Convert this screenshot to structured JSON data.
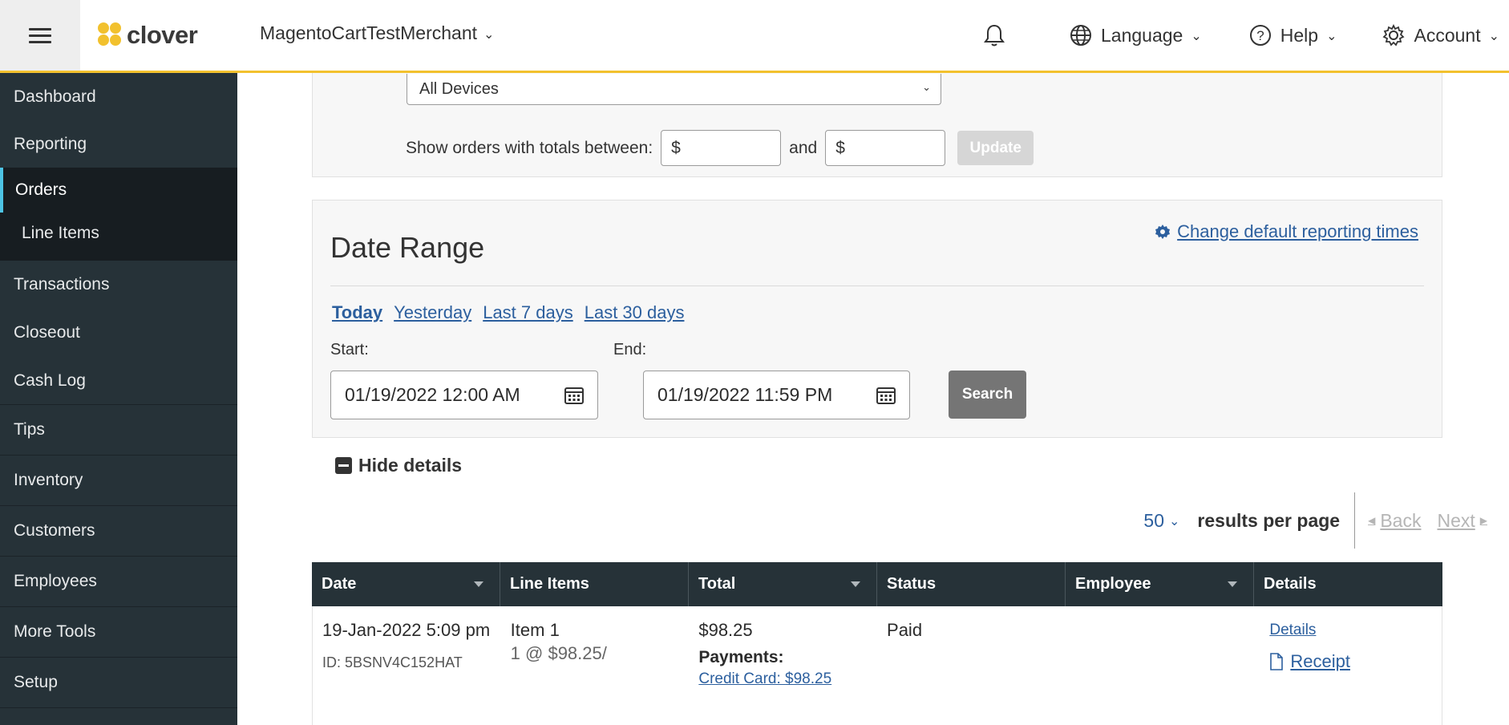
{
  "header": {
    "logo_text": "clover",
    "merchant": "MagentoCartTestMerchant",
    "language": "Language",
    "help": "Help",
    "account": "Account"
  },
  "sidebar": {
    "items": [
      {
        "label": "Dashboard"
      },
      {
        "label": "Reporting"
      },
      {
        "label": "Orders"
      },
      {
        "label": "Line Items"
      },
      {
        "label": "Transactions"
      },
      {
        "label": "Closeout"
      },
      {
        "label": "Cash Log"
      },
      {
        "label": "Tips"
      },
      {
        "label": "Inventory"
      },
      {
        "label": "Customers"
      },
      {
        "label": "Employees"
      },
      {
        "label": "More Tools"
      },
      {
        "label": "Setup"
      }
    ]
  },
  "filters": {
    "device_value": "All Devices",
    "totals_label": "Show orders with totals between:",
    "min_value": "$",
    "and_label": "and",
    "max_value": "$",
    "update_label": "Update"
  },
  "date_range": {
    "title": "Date Range",
    "change_link": "Change default reporting times",
    "quick": [
      "Today",
      "Yesterday",
      "Last 7 days",
      "Last 30 days"
    ],
    "start_label": "Start:",
    "start_value": "01/19/2022 12:00  AM",
    "end_label": "End:",
    "end_value": "01/19/2022 11:59  PM",
    "search_label": "Search"
  },
  "details_toggle": "Hide details",
  "pager": {
    "per_page": "50",
    "per_page_label": "results per page",
    "back": "Back",
    "next": "Next"
  },
  "table": {
    "columns": [
      "Date",
      "Line Items",
      "Total",
      "Status",
      "Employee",
      "Details"
    ],
    "rows": [
      {
        "date": "19-Jan-2022 5:09 pm",
        "id": "ID: 5BSNV4C152HAT",
        "item_name": "Item 1",
        "item_qty": "1 @ $98.25/",
        "total": "$98.25",
        "payments_label": "Payments:",
        "payment": "Credit Card: $98.25",
        "status": "Paid",
        "employee": "",
        "details_link": "Details",
        "receipt_link": "Receipt"
      }
    ]
  },
  "colors": {
    "accent_yellow": "#f2c12e",
    "sidebar_bg": "#263238",
    "link_blue": "#2c5f9e",
    "active_indicator": "#4dc4e5"
  },
  "icons": [
    "menu-icon",
    "bell-icon",
    "globe-icon",
    "help-icon",
    "gear-icon",
    "calendar-icon",
    "document-icon"
  ]
}
